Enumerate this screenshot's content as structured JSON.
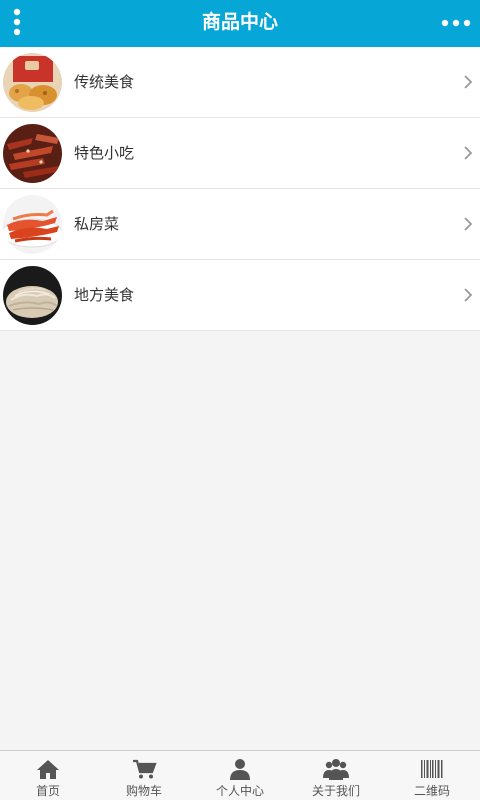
{
  "header": {
    "title": "商品中心",
    "bg_color": "#06a6d6",
    "left_icon": "vertical-dots-menu-icon",
    "right_icon": "horizontal-dots-more-icon"
  },
  "categories": [
    {
      "label": "传统美食",
      "image": "traditional-food-thumbnail"
    },
    {
      "label": "特色小吃",
      "image": "specialty-snack-thumbnail"
    },
    {
      "label": "私房菜",
      "image": "private-kitchen-dish-thumbnail"
    },
    {
      "label": "地方美食",
      "image": "local-food-thumbnail"
    }
  ],
  "bottom_nav": [
    {
      "label": "首页",
      "icon": "home-icon"
    },
    {
      "label": "购物车",
      "icon": "cart-icon"
    },
    {
      "label": "个人中心",
      "icon": "user-icon"
    },
    {
      "label": "关于我们",
      "icon": "group-icon"
    },
    {
      "label": "二维码",
      "icon": "barcode-icon"
    }
  ]
}
